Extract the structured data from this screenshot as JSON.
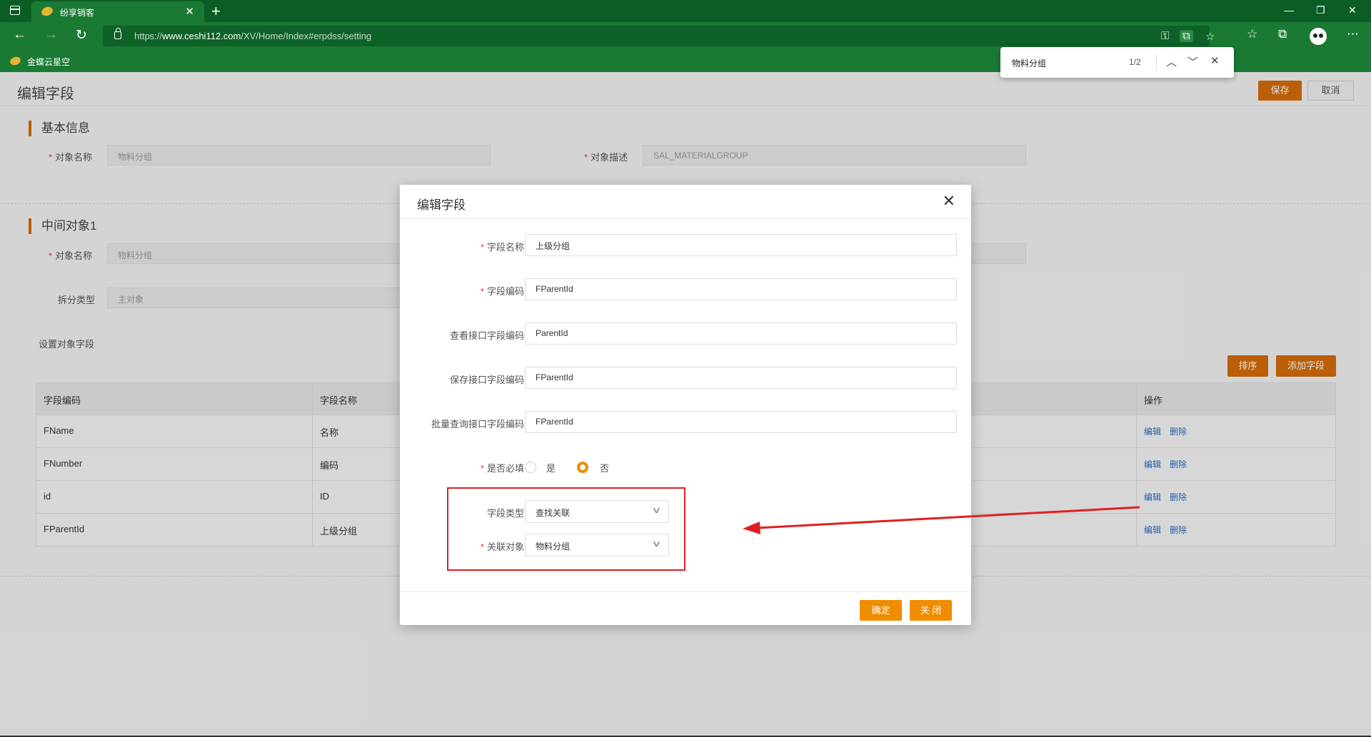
{
  "browser": {
    "tab_title": "纷享销客",
    "url_prefix": "https://",
    "url_host": "www.ceshi112.com",
    "url_path": "/XV/Home/Index#erpdss/setting",
    "bookmark": "金蝶云星空",
    "find": {
      "query": "物料分组",
      "count": "1/2"
    }
  },
  "page": {
    "title": "编辑字段",
    "save_label": "保存",
    "cancel_label": "取消",
    "basic_section": "基本信息",
    "object_name_label": "对象名称",
    "object_name_value": "物料分组",
    "object_desc_label": "对象描述",
    "object_desc_value": "SAL_MATERIALGROUP",
    "middle_section": "中间对象1",
    "mid_object_name_label": "对象名称",
    "mid_object_name_value": "物料分组",
    "split_type_label": "拆分类型",
    "split_type_value": "主对象",
    "set_fields_label": "设置对象字段",
    "sort_label": "排序",
    "add_field_label": "添加字段",
    "table": {
      "headers": [
        "字段编码",
        "字段名称",
        "操作"
      ],
      "rows": [
        {
          "code": "FName",
          "name": "名称"
        },
        {
          "code": "FNumber",
          "name": "编码"
        },
        {
          "code": "id",
          "name": "ID"
        },
        {
          "code": "FParentId",
          "name": "上级分组"
        }
      ],
      "edit_label": "编辑",
      "delete_label": "删除"
    }
  },
  "dialog": {
    "title": "编辑字段",
    "field_name_label": "字段名称",
    "field_name_value": "上级分组",
    "field_code_label": "字段编码",
    "field_code_value": "FParentId",
    "view_api_label": "查看接口字段编码",
    "view_api_value": "ParentId",
    "save_api_label": "保存接口字段编码",
    "save_api_value": "FParentId",
    "batch_api_label": "批量查询接口字段编码",
    "batch_api_value": "FParentId",
    "required_label": "是否必填",
    "required_yes": "是",
    "required_no": "否",
    "field_type_label": "字段类型",
    "field_type_value": "查找关联",
    "related_object_label": "关联对象",
    "related_object_value": "物料分组",
    "confirm_label": "确定",
    "close_label": "关 闭"
  },
  "colors": {
    "accent": "#d46b08",
    "dialog_accent": "#f08c00",
    "annotation": "#e02020",
    "browser_green": "#1a7a34"
  }
}
